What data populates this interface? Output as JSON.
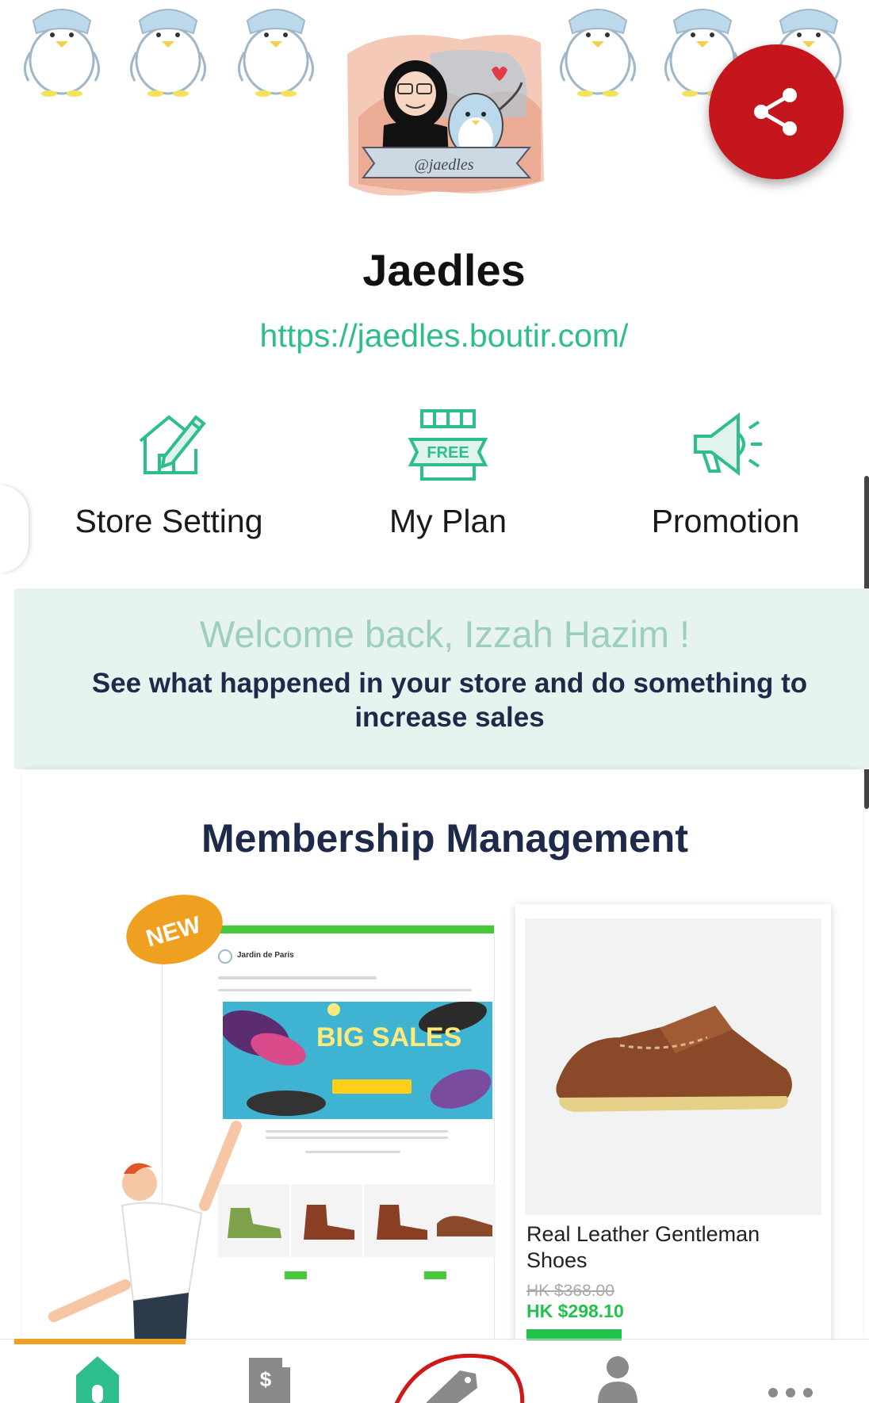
{
  "store": {
    "name": "Jaedles",
    "url": "https://jaedles.boutir.com/",
    "avatar_caption": "@jaedles"
  },
  "quick_actions": [
    {
      "label": "Store Setting",
      "icon": "house-pencil-icon"
    },
    {
      "label": "My Plan",
      "icon": "free-shop-icon",
      "badge": "FREE"
    },
    {
      "label": "Promotion",
      "icon": "megaphone-icon"
    }
  ],
  "welcome": {
    "title": "Welcome back, Izzah Hazim !",
    "subtitle": "See what happened in your store and do something to increase sales"
  },
  "feature_card": {
    "title": "Membership Management",
    "badge": "NEW",
    "mock_store_name": "Jardin de Paris",
    "hero_text": "BIG SALES",
    "product": {
      "name": "Real Leather Gentleman Shoes",
      "original_price": "HK $368.00",
      "price": "HK $298.10"
    }
  },
  "bottom_nav": [
    {
      "icon": "home-icon",
      "active": true
    },
    {
      "icon": "receipt-dollar-icon",
      "active": false
    },
    {
      "icon": "price-tag-icon",
      "active": false
    },
    {
      "icon": "person-icon",
      "active": false
    },
    {
      "icon": "more-dots-icon",
      "active": false
    }
  ],
  "colors": {
    "accent": "#2ebd8c",
    "share": "#c4161c",
    "welcome_bg": "#e6f3ee",
    "navy": "#1e2a4a"
  }
}
